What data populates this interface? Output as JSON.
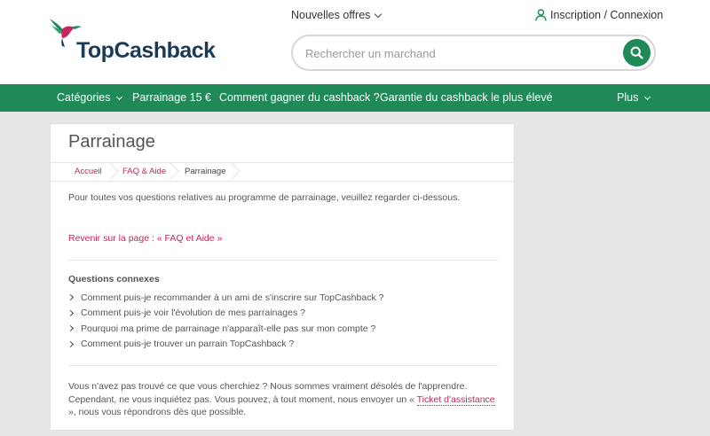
{
  "header": {
    "logo_text": "TopCashback",
    "deals_label": "Nouvelles offres",
    "account_label": "Inscription / Connexion",
    "search_placeholder": "Rechercher un marchand"
  },
  "nav": {
    "categories": "Catégories",
    "referral": "Parrainage 15 €",
    "how": "Comment gagner du cashback ?",
    "guarantee": "Garantie du cashback le plus élevé",
    "more": "Plus"
  },
  "page": {
    "title": "Parrainage",
    "breadcrumb": [
      "Accueil",
      "FAQ & Aide",
      "Parrainage"
    ],
    "intro": "Pour toutes vos questions relatives au programme de parrainage, veuillez regarder ci-dessous.",
    "back_link": "Revenir sur la page : « FAQ et Aide »",
    "related_title": "Questions connexes",
    "related": [
      "Comment puis-je recommander à un ami de s'inscrire sur TopCashback ?",
      "Comment puis-je voir l'évolution de mes parrainages ?",
      "Pourquoi ma prime de parrainage n'apparaît-elle pas sur mon compte ?",
      "Comment puis-je trouver un parrain TopCashback ?"
    ],
    "footer_before": "Vous n'avez pas trouvé ce que vous cherchiez ? Nous sommes vraiment désolés de l'apprendre. Cependant, ne vous inquiétez pas. Vous pouvez, à tout moment, nous envoyer un « ",
    "footer_link": "Ticket d'assistance",
    "footer_after": " », nous vous répondrons dès que possible."
  },
  "colors": {
    "brand_green": "#1f8a58",
    "link_pink": "#c8235c",
    "logo_navy": "#1b3a55"
  }
}
